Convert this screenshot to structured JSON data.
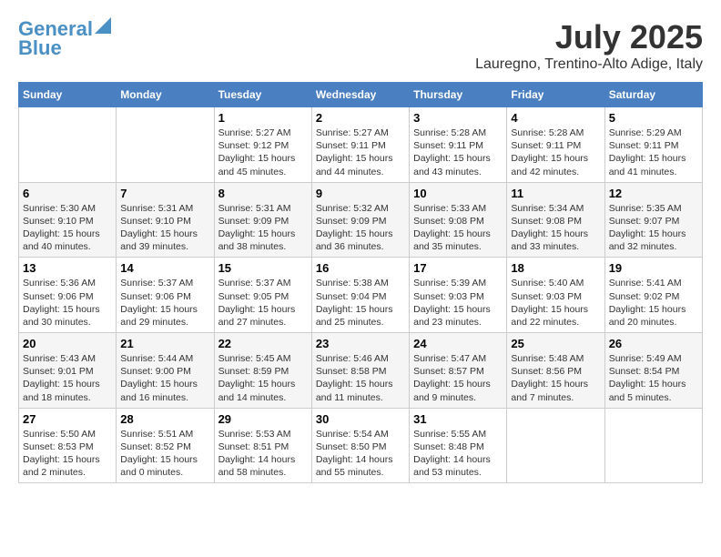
{
  "header": {
    "logo_line1": "General",
    "logo_line2": "Blue",
    "month_year": "July 2025",
    "location": "Lauregno, Trentino-Alto Adige, Italy"
  },
  "weekdays": [
    "Sunday",
    "Monday",
    "Tuesday",
    "Wednesday",
    "Thursday",
    "Friday",
    "Saturday"
  ],
  "weeks": [
    [
      {
        "day": "",
        "info": ""
      },
      {
        "day": "",
        "info": ""
      },
      {
        "day": "1",
        "info": "Sunrise: 5:27 AM\nSunset: 9:12 PM\nDaylight: 15 hours\nand 45 minutes."
      },
      {
        "day": "2",
        "info": "Sunrise: 5:27 AM\nSunset: 9:11 PM\nDaylight: 15 hours\nand 44 minutes."
      },
      {
        "day": "3",
        "info": "Sunrise: 5:28 AM\nSunset: 9:11 PM\nDaylight: 15 hours\nand 43 minutes."
      },
      {
        "day": "4",
        "info": "Sunrise: 5:28 AM\nSunset: 9:11 PM\nDaylight: 15 hours\nand 42 minutes."
      },
      {
        "day": "5",
        "info": "Sunrise: 5:29 AM\nSunset: 9:11 PM\nDaylight: 15 hours\nand 41 minutes."
      }
    ],
    [
      {
        "day": "6",
        "info": "Sunrise: 5:30 AM\nSunset: 9:10 PM\nDaylight: 15 hours\nand 40 minutes."
      },
      {
        "day": "7",
        "info": "Sunrise: 5:31 AM\nSunset: 9:10 PM\nDaylight: 15 hours\nand 39 minutes."
      },
      {
        "day": "8",
        "info": "Sunrise: 5:31 AM\nSunset: 9:09 PM\nDaylight: 15 hours\nand 38 minutes."
      },
      {
        "day": "9",
        "info": "Sunrise: 5:32 AM\nSunset: 9:09 PM\nDaylight: 15 hours\nand 36 minutes."
      },
      {
        "day": "10",
        "info": "Sunrise: 5:33 AM\nSunset: 9:08 PM\nDaylight: 15 hours\nand 35 minutes."
      },
      {
        "day": "11",
        "info": "Sunrise: 5:34 AM\nSunset: 9:08 PM\nDaylight: 15 hours\nand 33 minutes."
      },
      {
        "day": "12",
        "info": "Sunrise: 5:35 AM\nSunset: 9:07 PM\nDaylight: 15 hours\nand 32 minutes."
      }
    ],
    [
      {
        "day": "13",
        "info": "Sunrise: 5:36 AM\nSunset: 9:06 PM\nDaylight: 15 hours\nand 30 minutes."
      },
      {
        "day": "14",
        "info": "Sunrise: 5:37 AM\nSunset: 9:06 PM\nDaylight: 15 hours\nand 29 minutes."
      },
      {
        "day": "15",
        "info": "Sunrise: 5:37 AM\nSunset: 9:05 PM\nDaylight: 15 hours\nand 27 minutes."
      },
      {
        "day": "16",
        "info": "Sunrise: 5:38 AM\nSunset: 9:04 PM\nDaylight: 15 hours\nand 25 minutes."
      },
      {
        "day": "17",
        "info": "Sunrise: 5:39 AM\nSunset: 9:03 PM\nDaylight: 15 hours\nand 23 minutes."
      },
      {
        "day": "18",
        "info": "Sunrise: 5:40 AM\nSunset: 9:03 PM\nDaylight: 15 hours\nand 22 minutes."
      },
      {
        "day": "19",
        "info": "Sunrise: 5:41 AM\nSunset: 9:02 PM\nDaylight: 15 hours\nand 20 minutes."
      }
    ],
    [
      {
        "day": "20",
        "info": "Sunrise: 5:43 AM\nSunset: 9:01 PM\nDaylight: 15 hours\nand 18 minutes."
      },
      {
        "day": "21",
        "info": "Sunrise: 5:44 AM\nSunset: 9:00 PM\nDaylight: 15 hours\nand 16 minutes."
      },
      {
        "day": "22",
        "info": "Sunrise: 5:45 AM\nSunset: 8:59 PM\nDaylight: 15 hours\nand 14 minutes."
      },
      {
        "day": "23",
        "info": "Sunrise: 5:46 AM\nSunset: 8:58 PM\nDaylight: 15 hours\nand 11 minutes."
      },
      {
        "day": "24",
        "info": "Sunrise: 5:47 AM\nSunset: 8:57 PM\nDaylight: 15 hours\nand 9 minutes."
      },
      {
        "day": "25",
        "info": "Sunrise: 5:48 AM\nSunset: 8:56 PM\nDaylight: 15 hours\nand 7 minutes."
      },
      {
        "day": "26",
        "info": "Sunrise: 5:49 AM\nSunset: 8:54 PM\nDaylight: 15 hours\nand 5 minutes."
      }
    ],
    [
      {
        "day": "27",
        "info": "Sunrise: 5:50 AM\nSunset: 8:53 PM\nDaylight: 15 hours\nand 2 minutes."
      },
      {
        "day": "28",
        "info": "Sunrise: 5:51 AM\nSunset: 8:52 PM\nDaylight: 15 hours\nand 0 minutes."
      },
      {
        "day": "29",
        "info": "Sunrise: 5:53 AM\nSunset: 8:51 PM\nDaylight: 14 hours\nand 58 minutes."
      },
      {
        "day": "30",
        "info": "Sunrise: 5:54 AM\nSunset: 8:50 PM\nDaylight: 14 hours\nand 55 minutes."
      },
      {
        "day": "31",
        "info": "Sunrise: 5:55 AM\nSunset: 8:48 PM\nDaylight: 14 hours\nand 53 minutes."
      },
      {
        "day": "",
        "info": ""
      },
      {
        "day": "",
        "info": ""
      }
    ]
  ]
}
